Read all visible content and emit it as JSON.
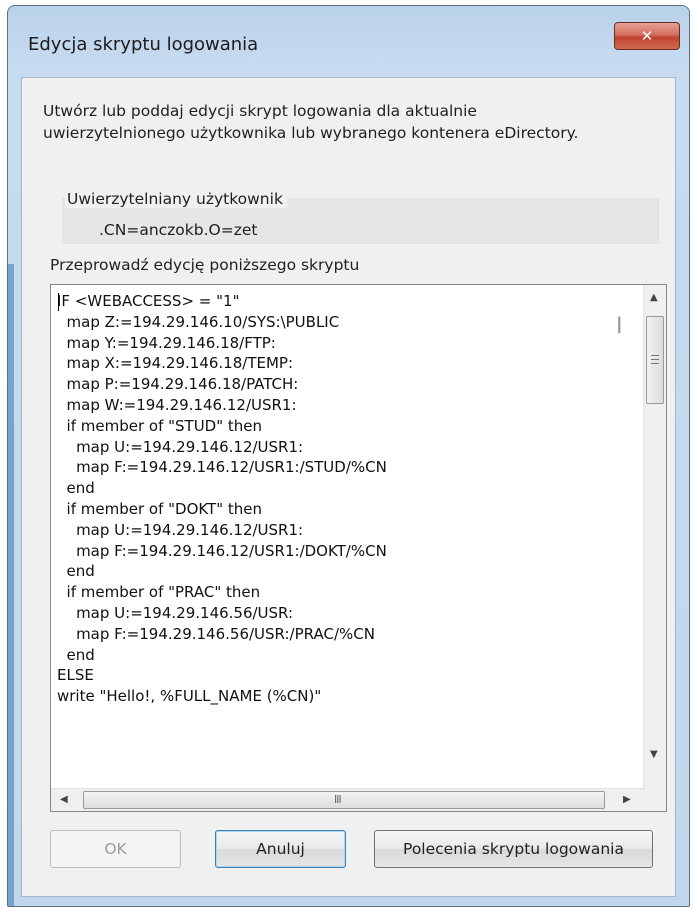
{
  "window": {
    "title": "Edycja skryptu logowania",
    "close_glyph": "✕"
  },
  "dialog": {
    "description_line1": "Utwórz lub poddaj edycji skrypt logowania dla aktualnie",
    "description_line2": "uwierzytelnionego użytkownika lub wybranego kontenera eDirectory.",
    "auth_user_label": "Uwierzytelniany użytkownik",
    "auth_user_value": ".CN=anczokb.O=zet",
    "edit_label": "Przeprowadź edycję poniższego skryptu",
    "script_lines": [
      "IF <WEBACCESS> = \"1\"",
      "  map Z:=194.29.146.10/SYS:\\PUBLIC",
      "  map Y:=194.29.146.18/FTP:",
      "  map X:=194.29.146.18/TEMP:",
      "  map P:=194.29.146.18/PATCH:",
      "  map W:=194.29.146.12/USR1:",
      "  if member of \"STUD\" then",
      "    map U:=194.29.146.12/USR1:",
      "    map F:=194.29.146.12/USR1:/STUD/%CN",
      "  end",
      "  if member of \"DOKT\" then",
      "    map U:=194.29.146.12/USR1:",
      "    map F:=194.29.146.12/USR1:/DOKT/%CN",
      "  end",
      "  if member of \"PRAC\" then",
      "    map U:=194.29.146.56/USR:",
      "    map F:=194.29.146.56/USR:/PRAC/%CN",
      "  end",
      "ELSE",
      "write \"Hello!, %FULL_NAME (%CN)\""
    ],
    "hscroll_grip": "III"
  },
  "buttons": {
    "ok": "OK",
    "cancel": "Anuluj",
    "commands": "Polecenia skryptu logowania"
  },
  "colors": {
    "title_bar": "#b9d1ea",
    "client_bg": "#f0f0f0",
    "close_button": "#c0422f",
    "default_button_border": "#3c7fb1"
  }
}
